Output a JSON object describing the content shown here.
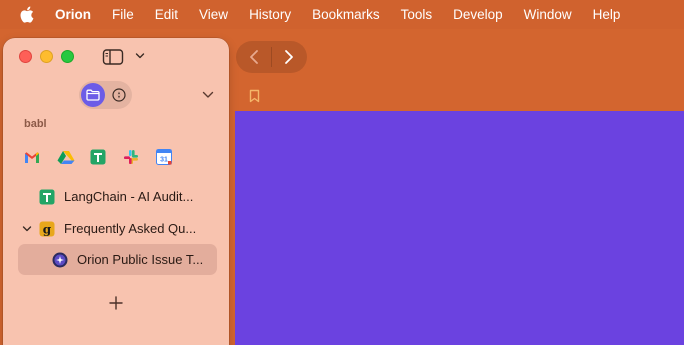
{
  "menubar": {
    "apple_icon": "apple-logo",
    "app_name": "Orion",
    "items": [
      "File",
      "Edit",
      "View",
      "History",
      "Bookmarks",
      "Tools",
      "Develop",
      "Window",
      "Help"
    ]
  },
  "sidebar": {
    "space_name": "babl",
    "pinned": [
      {
        "name": "gmail-icon"
      },
      {
        "name": "google-drive-icon"
      },
      {
        "name": "google-sheets-icon"
      },
      {
        "name": "slack-icon"
      },
      {
        "name": "google-calendar-icon"
      }
    ],
    "tabs": [
      {
        "label": "LangChain - AI Audit...",
        "icon": "google-sheets-icon"
      },
      {
        "label": "Frequently Asked Qu...",
        "icon": "gumroad-icon",
        "expanded": true
      },
      {
        "label": "Orion Public Issue T...",
        "icon": "orion-icon",
        "selected": true
      }
    ]
  },
  "colors": {
    "menubar": "#D0622E",
    "sidebar": "#F8C3AF",
    "content": "#6B42E0",
    "accent": "#6C5CE7"
  }
}
